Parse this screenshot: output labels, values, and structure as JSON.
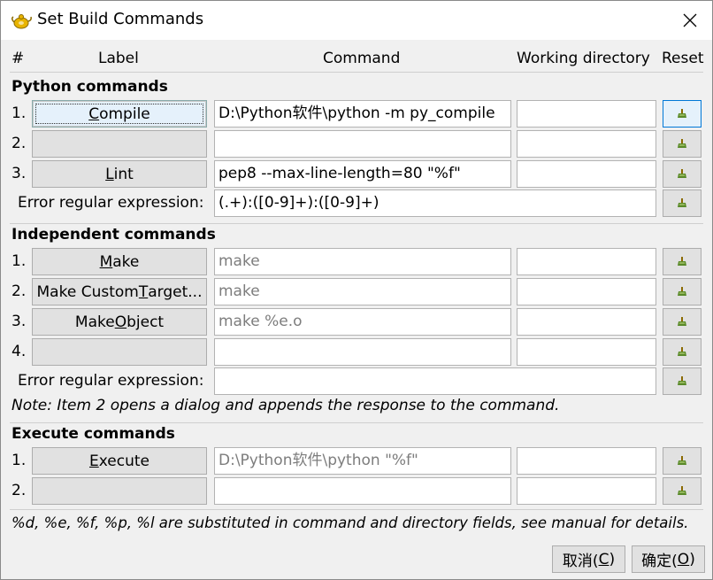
{
  "window": {
    "title": "Set Build Commands"
  },
  "headers": {
    "num": "#",
    "label": "Label",
    "command": "Command",
    "workdir": "Working directory",
    "reset": "Reset"
  },
  "python": {
    "title": "Python commands",
    "rows": [
      {
        "num": "1.",
        "label_pre": "",
        "label_u": "C",
        "label_post": "ompile",
        "command": "D:\\Python软件\\python -m py_compile",
        "command_placeholder": false,
        "workdir": ""
      },
      {
        "num": "2.",
        "label_pre": "",
        "label_u": "",
        "label_post": "",
        "command": "",
        "command_placeholder": false,
        "workdir": ""
      },
      {
        "num": "3.",
        "label_pre": "",
        "label_u": "L",
        "label_post": "int",
        "command": "pep8 --max-line-length=80 \"%f\"",
        "command_placeholder": false,
        "workdir": ""
      }
    ],
    "error_label": "Error regular expression:",
    "error_value": "(.+):([0-9]+):([0-9]+)"
  },
  "independent": {
    "title": "Independent commands",
    "rows": [
      {
        "num": "1.",
        "label_pre": "",
        "label_u": "M",
        "label_post": "ake",
        "command": "make",
        "command_placeholder": true,
        "workdir": ""
      },
      {
        "num": "2.",
        "label_pre": "Make Custom ",
        "label_u": "T",
        "label_post": "arget...",
        "command": "make",
        "command_placeholder": true,
        "workdir": ""
      },
      {
        "num": "3.",
        "label_pre": "Make ",
        "label_u": "O",
        "label_post": "bject",
        "command": "make %e.o",
        "command_placeholder": true,
        "workdir": ""
      },
      {
        "num": "4.",
        "label_pre": "",
        "label_u": "",
        "label_post": "",
        "command": "",
        "command_placeholder": false,
        "workdir": ""
      }
    ],
    "error_label": "Error regular expression:",
    "error_value": ""
  },
  "note": "Note: Item 2 opens a dialog and appends the response to the command.",
  "execute": {
    "title": "Execute commands",
    "rows": [
      {
        "num": "1.",
        "label_pre": "",
        "label_u": "E",
        "label_post": "xecute",
        "command": "D:\\Python软件\\python \"%f\"",
        "command_placeholder": true,
        "workdir": ""
      },
      {
        "num": "2.",
        "label_pre": "",
        "label_u": "",
        "label_post": "",
        "command": "",
        "command_placeholder": false,
        "workdir": ""
      }
    ]
  },
  "footer_note": "%d, %e, %f, %p, %l are substituted in command and directory fields, see manual for details.",
  "buttons": {
    "cancel_pre": "取消(",
    "cancel_u": "C",
    "cancel_post": ")",
    "ok_pre": "确定(",
    "ok_u": "O",
    "ok_post": ")"
  },
  "icons": {
    "app": "geany-teapot-icon",
    "close": "close-icon",
    "reset": "clear-broom-icon"
  },
  "colors": {
    "titlebar": "#ffffff",
    "dialog_bg": "#f0f0f0",
    "button_bg": "#e1e1e1",
    "focus_border": "#0078d7",
    "placeholder_text": "#7d7d7d"
  }
}
